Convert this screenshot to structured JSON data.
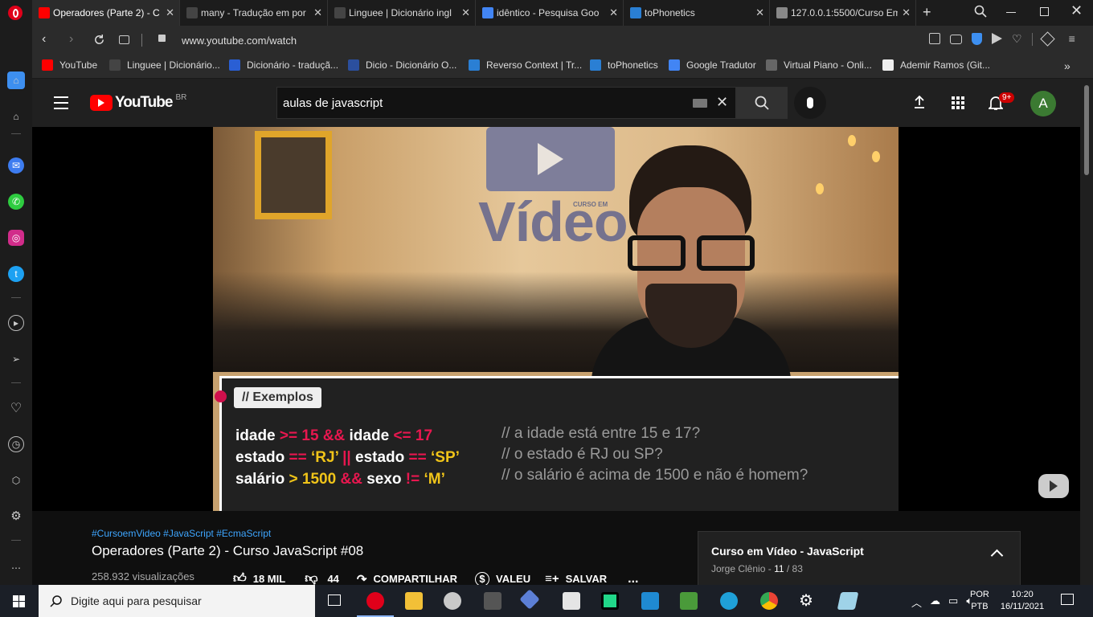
{
  "browser": {
    "tabs": [
      {
        "title": "Operadores (Parte 2) - C",
        "active": true,
        "color": "#ff0000"
      },
      {
        "title": "many - Tradução em por",
        "active": false,
        "color": "#444"
      },
      {
        "title": "Linguee | Dicionário ingl",
        "active": false,
        "color": "#444"
      },
      {
        "title": "idêntico - Pesquisa Goo",
        "active": false,
        "color": "#4285f4"
      },
      {
        "title": "toPhonetics",
        "active": false,
        "color": "#2a7fd4"
      },
      {
        "title": "127.0.0.1:5500/Curso Em",
        "active": false,
        "color": "#888"
      }
    ],
    "url": "www.youtube.com/watch",
    "bookmarks": [
      {
        "label": "YouTube",
        "color": "#ff0000"
      },
      {
        "label": "Linguee | Dicionário...",
        "color": "#444"
      },
      {
        "label": "Dicionário - traduçã...",
        "color": "#2a5fd4"
      },
      {
        "label": "Dicio - Dicionário O...",
        "color": "#2b4f9e"
      },
      {
        "label": "Reverso Context | Tr...",
        "color": "#2a7fd4"
      },
      {
        "label": "toPhonetics",
        "color": "#2a7fd4"
      },
      {
        "label": "Google Tradutor",
        "color": "#4285f4"
      },
      {
        "label": "Virtual Piano - Onli...",
        "color": "#666"
      },
      {
        "label": "Ademir Ramos (Git...",
        "color": "#eee"
      }
    ],
    "more_label": "»"
  },
  "youtube": {
    "logo_text": "YouTube",
    "region": "BR",
    "search_value": "aulas de javascript",
    "notifications": "9+",
    "avatar_letter": "A",
    "avatar_color": "#3b7a32"
  },
  "video_frame": {
    "wall_text": "Vídeo",
    "wall_small": "CURSO EM",
    "slide_title": "// Exemplos",
    "code_lines": [
      {
        "parts": [
          [
            "idade ",
            "w"
          ],
          [
            ">= 15 ",
            "r"
          ],
          [
            "&& ",
            "r"
          ],
          [
            "idade ",
            "w"
          ],
          [
            "<= 17",
            "r"
          ]
        ],
        "comment": "// a idade está entre 15 e 17?"
      },
      {
        "parts": [
          [
            "estado ",
            "w"
          ],
          [
            "== ",
            "r"
          ],
          [
            "‘RJ’ ",
            "y"
          ],
          [
            "|| ",
            "r"
          ],
          [
            "estado ",
            "w"
          ],
          [
            "== ",
            "r"
          ],
          [
            "‘SP’",
            "y"
          ]
        ],
        "comment": "// o estado é RJ ou SP?"
      },
      {
        "parts": [
          [
            "salário ",
            "w"
          ],
          [
            "> 1500 ",
            "y"
          ],
          [
            "&& ",
            "r"
          ],
          [
            "sexo ",
            "w"
          ],
          [
            "!= ",
            "r"
          ],
          [
            "‘M’",
            "y"
          ]
        ],
        "comment": "// o salário é acima de 1500 e não é homem?"
      }
    ]
  },
  "video_info": {
    "hashtags": "#CursoemVideo #JavaScript #EcmaScript",
    "title": "Operadores (Parte 2) - Curso JavaScript #08",
    "views": "258.932 visualizações",
    "likes": "18 MIL",
    "dislikes": "44",
    "share_label": "COMPARTILHAR",
    "thanks_label": "VALEU",
    "save_label": "SALVAR",
    "more_label": "..."
  },
  "playlist": {
    "title": "Curso em Vídeo - JavaScript",
    "author": "Jorge Clênio",
    "position": "11",
    "total": "/ 83"
  },
  "taskbar": {
    "search_placeholder": "Digite aqui para pesquisar",
    "lang_top": "POR",
    "lang_bottom": "PTB",
    "time": "10:20",
    "date": "16/11/2021"
  }
}
